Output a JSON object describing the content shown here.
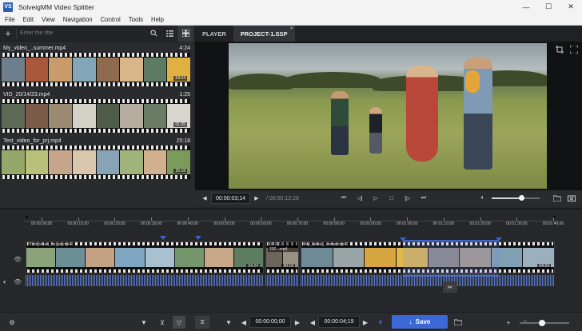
{
  "app": {
    "title": "SolveigMM Video Splitter",
    "logo": "VS"
  },
  "window_controls": {
    "minimize": "—",
    "maximize": "☐",
    "close": "✕"
  },
  "menu": [
    "File",
    "Edit",
    "View",
    "Navigation",
    "Control",
    "Tools",
    "Help"
  ],
  "search": {
    "placeholder": "Enter the title",
    "value": ""
  },
  "clips": [
    {
      "name": "My_video_..summer.mp4",
      "duration": "4:24",
      "frame_tag": "04:24"
    },
    {
      "name": "VID_20/14/23.mp4",
      "duration": "1:25",
      "frame_tag": "01:25"
    },
    {
      "name": "Test_video_for_prj.mp4",
      "duration": "25:18",
      "frame_tag": "25:18"
    }
  ],
  "tabs": {
    "player": "PLAYER",
    "project": "PROJECT-1.SSP",
    "project_close": "×"
  },
  "player": {
    "current_time": "00:00:03;14",
    "total_time": "/ 00:00:12;26",
    "volume": 0.62
  },
  "ruler_labels": [
    "00:00:00;00",
    "00:00:10;00",
    "00:00:20;00",
    "00:00:30;00",
    "00:00:40;00",
    "00:00:50;00",
    "00:00:60;00",
    "00:00:70;00",
    "00:00:80;00",
    "00:00:90;00",
    "00:01:00;00",
    "00:01:10;00",
    "00:01:20;00",
    "00:01:30;00",
    "00:01:40;00"
  ],
  "timeline_clips": [
    {
      "title": "Test_video_for_prj.mp4",
      "tag": "04:24"
    },
    {
      "title": "07-02-202...mp4",
      "tag": "00:18"
    },
    {
      "title": "My_video_...mmer.mp4",
      "tag": "04:24"
    }
  ],
  "bottom": {
    "start_time": "00:00:00;00",
    "end_time": "00:00:04;19",
    "save_label": "Save"
  },
  "colors": {
    "accent": "#3b68d6",
    "audio_wave": "#5a7fd8",
    "background": "#26272b"
  },
  "icons": [
    "search-icon",
    "list-view-icon",
    "grid-view-icon",
    "crop-icon",
    "fullscreen-icon",
    "volume-icon",
    "folder-icon",
    "snapshot-icon",
    "filter-icon",
    "save-icon",
    "settings-icon",
    "scissors-icon",
    "eye-icon"
  ]
}
